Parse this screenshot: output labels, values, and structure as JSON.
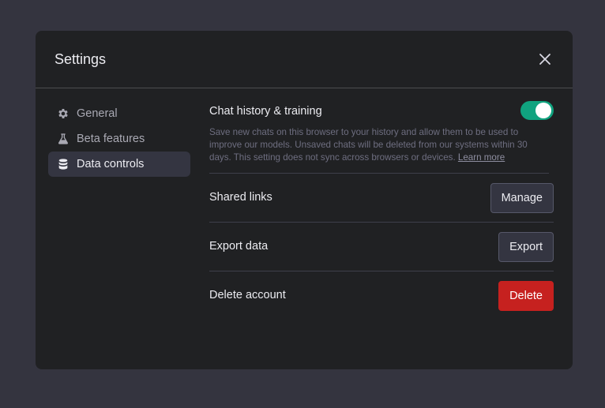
{
  "dialog": {
    "title": "Settings",
    "close_icon": "close-icon"
  },
  "sidebar": {
    "items": [
      {
        "label": "General",
        "icon": "gear-icon",
        "active": false
      },
      {
        "label": "Beta features",
        "icon": "flask-icon",
        "active": false
      },
      {
        "label": "Data controls",
        "icon": "database-icon",
        "active": true
      }
    ]
  },
  "chat_history": {
    "title": "Chat history & training",
    "toggle_on": true,
    "description": "Save new chats on this browser to your history and allow them to be used to improve our models. Unsaved chats will be deleted from our systems within 30 days. This setting does not sync across browsers or devices.",
    "learn_more": "Learn more"
  },
  "rows": {
    "shared_links": {
      "label": "Shared links",
      "button": "Manage"
    },
    "export_data": {
      "label": "Export data",
      "button": "Export"
    },
    "delete_account": {
      "label": "Delete account",
      "button": "Delete"
    }
  },
  "colors": {
    "toggle_on": "#10a37f",
    "danger": "#c6211f",
    "modal_bg": "#202123",
    "page_bg": "#34343f"
  }
}
